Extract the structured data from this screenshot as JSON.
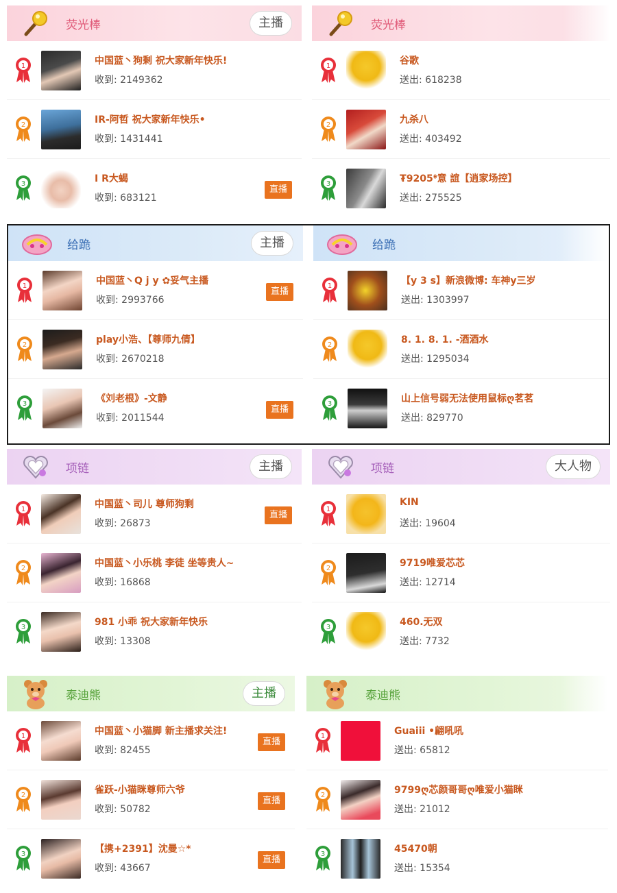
{
  "sections": [
    {
      "gift": "荧光棒",
      "left": {
        "tag": "主播",
        "rows": [
          {
            "rank": "1",
            "name": "中国蓝丶狗剩 祝大家新年快乐!",
            "stat": "收到: 2149362",
            "live": false
          },
          {
            "rank": "2",
            "name": "IR-阿哲 祝大家新年快乐•",
            "stat": "收到: 1431441",
            "live": false
          },
          {
            "rank": "3",
            "name": "I R大蝎",
            "stat": "收到: 683121",
            "live": true
          }
        ]
      },
      "right": {
        "tag": "",
        "rows": [
          {
            "rank": "1",
            "name": "谷歌",
            "stat": "送出: 618238"
          },
          {
            "rank": "2",
            "name": "九杀八",
            "stat": "送出: 403492"
          },
          {
            "rank": "3",
            "name": "₮9205ᶿ意 誼【逍家场控】",
            "stat": "送出: 275525"
          }
        ]
      }
    },
    {
      "gift": "给跪",
      "left": {
        "tag": "主播",
        "rows": [
          {
            "rank": "1",
            "name": "中国蓝丶Q j y ✿妥气主播",
            "stat": "收到: 2993766",
            "live": true
          },
          {
            "rank": "2",
            "name": "play小浩、【尊师九倩】",
            "stat": "收到: 2670218",
            "live": false
          },
          {
            "rank": "3",
            "name": "《刘老根》-文静",
            "stat": "收到: 2011544",
            "live": true
          }
        ]
      },
      "right": {
        "tag": "",
        "rows": [
          {
            "rank": "1",
            "name": "【y 3 s】新浪微博: 车神y三岁",
            "stat": "送出: 1303997"
          },
          {
            "rank": "2",
            "name": "8. 1. 8. 1. -酒酒水",
            "stat": "送出: 1295034"
          },
          {
            "rank": "3",
            "name": "山上信号弱无法使用鼠标ღ茗茗",
            "stat": "送出: 829770"
          }
        ]
      }
    },
    {
      "gift": "项链",
      "left": {
        "tag": "主播",
        "rows": [
          {
            "rank": "1",
            "name": "中国蓝丶司儿 尊师狗剩",
            "stat": "收到: 26873",
            "live": true
          },
          {
            "rank": "2",
            "name": "中国蓝丶小乐桃 李徒 坐等贵人~",
            "stat": "收到: 16868",
            "live": false
          },
          {
            "rank": "3",
            "name": "981 小乖 祝大家新年快乐",
            "stat": "收到: 13308",
            "live": false
          }
        ]
      },
      "right": {
        "tag": "大人物",
        "rows": [
          {
            "rank": "1",
            "name": "KIN",
            "stat": "送出: 19604"
          },
          {
            "rank": "2",
            "name": "9719唯爱芯芯",
            "stat": "送出: 12714"
          },
          {
            "rank": "3",
            "name": "460.无双",
            "stat": "送出: 7732"
          }
        ]
      }
    },
    {
      "gift": "泰迪熊",
      "left": {
        "tag": "主播",
        "rows": [
          {
            "rank": "1",
            "name": "中国蓝丶小猫脚 新主播求关注!",
            "stat": "收到: 82455",
            "live": true
          },
          {
            "rank": "2",
            "name": "雀跃-小猫眯尊师六爷",
            "stat": "收到: 50782",
            "live": true
          },
          {
            "rank": "3",
            "name": "【携+2391】沈曼☆*",
            "stat": "收到: 43667",
            "live": true
          }
        ]
      },
      "right": {
        "tag": "",
        "rows": [
          {
            "rank": "1",
            "name": "Guaiii •翩吼吼",
            "stat": "送出: 65812"
          },
          {
            "rank": "2",
            "name": "9799ღ芯颜哥哥ღ唯爱小猫眯",
            "stat": "送出: 21012"
          },
          {
            "rank": "3",
            "name": "45470朝",
            "stat": "送出: 15354"
          }
        ]
      }
    }
  ],
  "live_label": "直播",
  "colors": {
    "rank1": "#e8303a",
    "rank2": "#ef8a1c",
    "rank3": "#2e9e3a",
    "name": "#c8581f",
    "live_bg": "#e9731f"
  }
}
